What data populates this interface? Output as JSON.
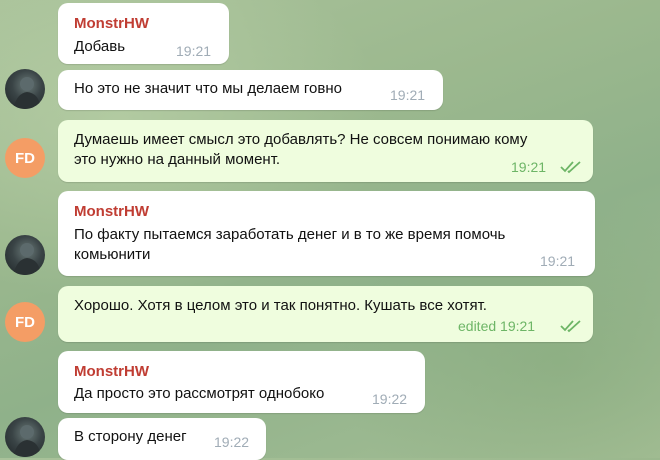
{
  "messages": [
    {
      "sender": "MonstrHW",
      "text": "Добавь",
      "time": "19:21"
    },
    {
      "text": "Но это не значит что мы делаем говно",
      "time": "19:21"
    },
    {
      "text_line1": "Думаешь имеет смысл это добавлять? Не совсем понимаю кому",
      "text_line2": "это нужно на данный момент.",
      "time": "19:21",
      "avatar": "FD"
    },
    {
      "sender": "MonstrHW",
      "text_line1": "По факту пытаемся заработать денег и в то же время помочь",
      "text_line2": "комьюнити",
      "time": "19:21"
    },
    {
      "text": "Хорошо. Хотя в целом это и так понятно. Кушать все хотят.",
      "time": "edited 19:21",
      "avatar": "FD"
    },
    {
      "sender": "MonstrHW",
      "text": "Да просто это рассмотрят однобоко",
      "time": "19:22"
    },
    {
      "text": "В сторону денег",
      "time": "19:22"
    }
  ],
  "colors": {
    "sender": "#c03d33",
    "outgoing_bubble": "#effdde",
    "incoming_bubble": "#ffffff",
    "read_check": "#6db566",
    "fd_avatar": "#f49d65"
  }
}
